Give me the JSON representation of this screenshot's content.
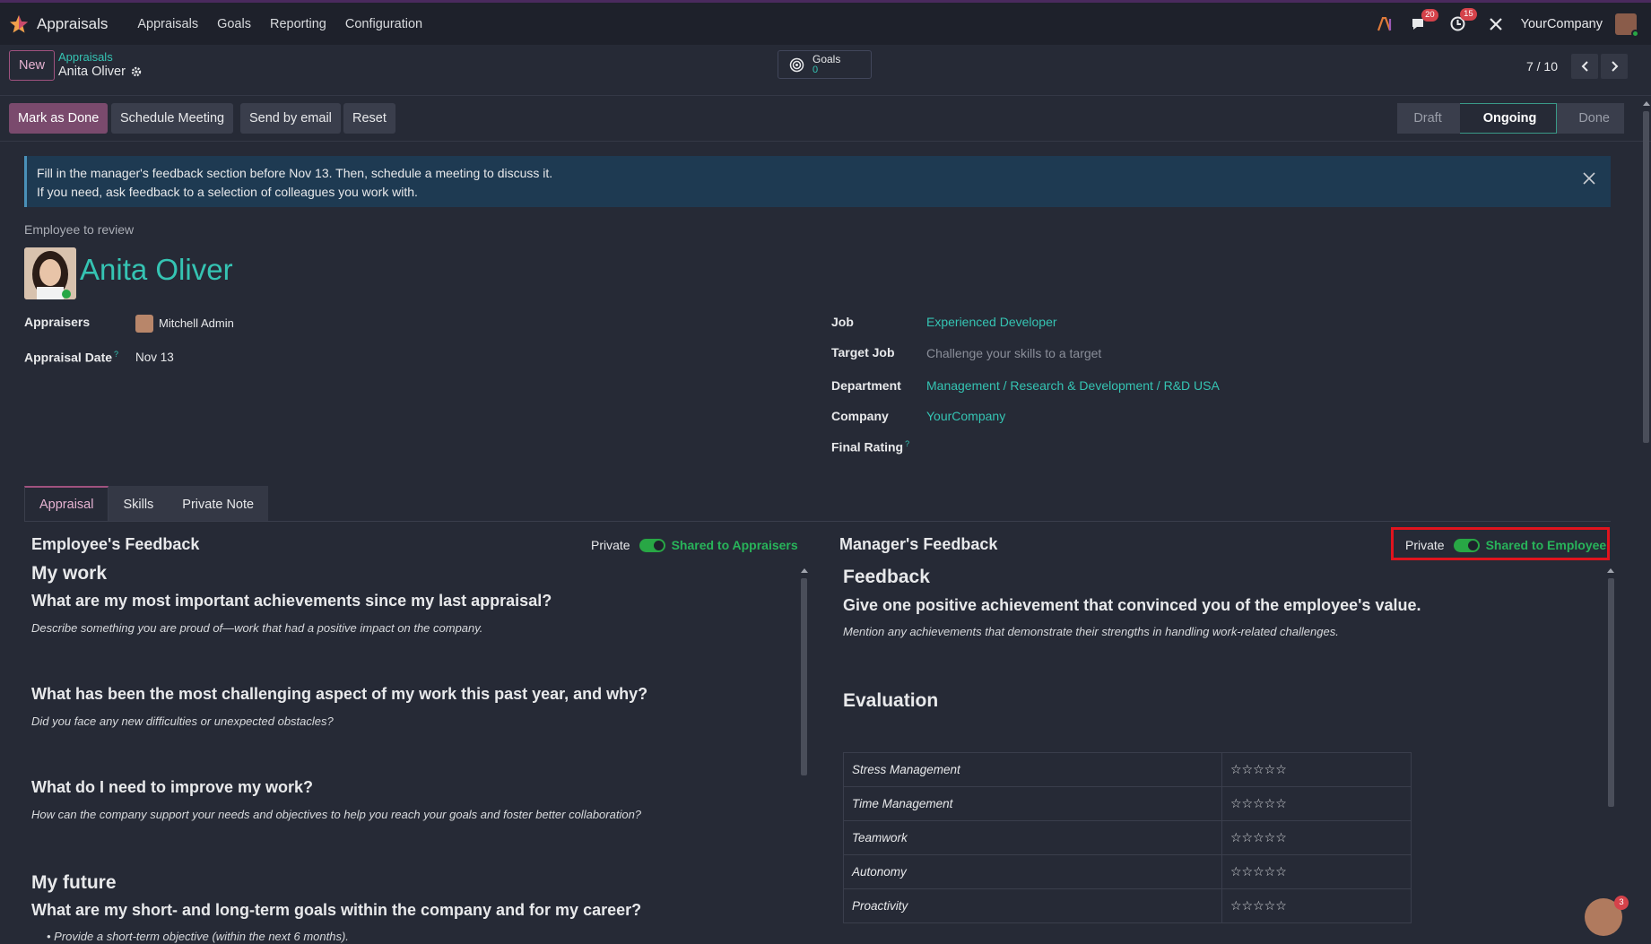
{
  "navbar": {
    "app_name": "Appraisals",
    "menu": [
      "Appraisals",
      "Goals",
      "Reporting",
      "Configuration"
    ],
    "messages_count": "20",
    "activities_count": "15",
    "company": "YourCompany"
  },
  "control": {
    "new_label": "New",
    "breadcrumb_parent": "Appraisals",
    "breadcrumb_current": "Anita Oliver",
    "goals_label": "Goals",
    "goals_value": "0",
    "pager": "7 / 10"
  },
  "actions": {
    "mark_done": "Mark as Done",
    "schedule_meeting": "Schedule Meeting",
    "send_email": "Send by email",
    "reset": "Reset"
  },
  "stages": {
    "draft": "Draft",
    "ongoing": "Ongoing",
    "done": "Done",
    "current": "Ongoing"
  },
  "alert": {
    "line1": "Fill in the manager's feedback section before Nov 13. Then, schedule a meeting to discuss it.",
    "line2": "If you need, ask feedback to a selection of colleagues you work with."
  },
  "employee": {
    "section_label": "Employee to review",
    "name": "Anita Oliver"
  },
  "fields_left": {
    "appraisers_label": "Appraisers",
    "appraisers_value": "Mitchell Admin",
    "date_label": "Appraisal Date",
    "date_value": "Nov 13"
  },
  "fields_right": {
    "job_label": "Job",
    "job_value": "Experienced Developer",
    "target_label": "Target Job",
    "target_placeholder": "Challenge your skills to a target",
    "dept_label": "Department",
    "dept_value": "Management / Research & Development / R&D USA",
    "company_label": "Company",
    "company_value": "YourCompany",
    "rating_label": "Final Rating"
  },
  "tabs": [
    "Appraisal",
    "Skills",
    "Private Note"
  ],
  "employee_feedback": {
    "title": "Employee's Feedback",
    "private_label": "Private",
    "shared_label": "Shared to Appraisers",
    "my_work": "My work",
    "q1": "What are my most important achievements since my last appraisal?",
    "q1_hint": "Describe something you are proud of—work that had a positive impact on the company.",
    "q2": "What has been the most challenging aspect of my work this past year, and why?",
    "q2_hint": "Did you face any new difficulties or unexpected obstacles?",
    "q3": "What do I need to improve my work?",
    "q3_hint": "How can the company support your needs and objectives to help you reach your goals and foster better collaboration?",
    "my_future": "My future",
    "q4": "What are my short- and long-term goals within the company and for my career?",
    "q4_bullet": "Provide a short-term objective (within the next 6 months)."
  },
  "manager_feedback": {
    "title": "Manager's Feedback",
    "private_label": "Private",
    "shared_label": "Shared to Employee",
    "feedback_heading": "Feedback",
    "q1": "Give one positive achievement that convinced you of the employee's value.",
    "q1_hint": "Mention any achievements that demonstrate their strengths in handling work-related challenges.",
    "evaluation_heading": "Evaluation",
    "evaluation_rows": [
      {
        "criterion": "Stress Management",
        "stars": "☆☆☆☆☆"
      },
      {
        "criterion": "Time Management",
        "stars": "☆☆☆☆☆"
      },
      {
        "criterion": "Teamwork",
        "stars": "☆☆☆☆☆"
      },
      {
        "criterion": "Autonomy",
        "stars": "☆☆☆☆☆"
      },
      {
        "criterion": "Proactivity",
        "stars": "☆☆☆☆☆"
      }
    ]
  },
  "chat_bot_badge": "3"
}
